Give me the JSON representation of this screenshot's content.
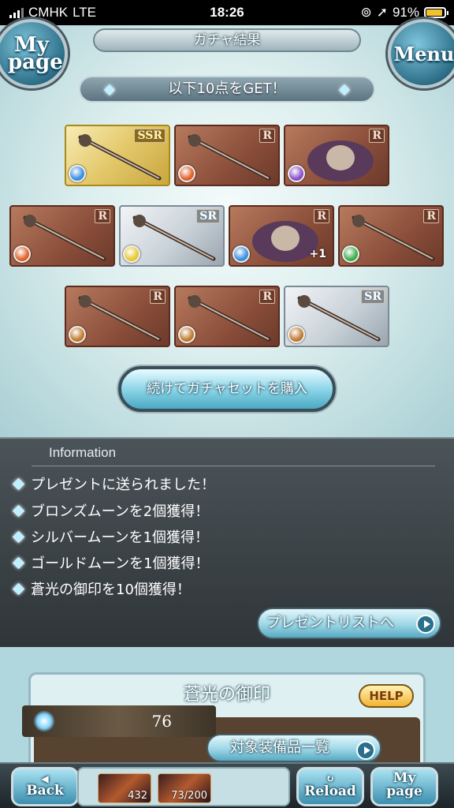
{
  "status": {
    "carrier": "CMHK",
    "network": "LTE",
    "time": "18:26",
    "battery": "91%",
    "battery_level": 0.91
  },
  "header": {
    "title": "ガチャ結果",
    "mypage_label": "My page",
    "menu_label": "Menu"
  },
  "banner": "以下10点をGET！",
  "cards": [
    {
      "rarity": "SSR",
      "element": "water",
      "color": "#3a8fe0"
    },
    {
      "rarity": "R",
      "element": "fire",
      "color": "#e0602a"
    },
    {
      "rarity": "R",
      "element": "dark",
      "color": "#8a4fc9"
    },
    {
      "rarity": "R",
      "element": "fire",
      "color": "#e0602a"
    },
    {
      "rarity": "SR",
      "element": "light",
      "color": "#e8c830"
    },
    {
      "rarity": "R",
      "element": "water",
      "color": "#3a8fe0",
      "bonus": "+1"
    },
    {
      "rarity": "R",
      "element": "wind",
      "color": "#3fae4a"
    },
    {
      "rarity": "R",
      "element": "earth",
      "color": "#c07a2e"
    },
    {
      "rarity": "R",
      "element": "earth",
      "color": "#c07a2e"
    },
    {
      "rarity": "SR",
      "element": "earth",
      "color": "#c07a2e"
    }
  ],
  "buy_button": "続けてガチャセットを購入",
  "info": {
    "heading": "Information",
    "messages": [
      "プレゼントに送られました！",
      "ブロンズムーンを2個獲得！",
      "シルバームーンを1個獲得！",
      "ゴールドムーンを1個獲得！",
      "蒼光の御印を10個獲得！"
    ],
    "present_button": "プレゼントリストへ"
  },
  "panel": {
    "title": "蒼光の御印",
    "help": "HELP",
    "count": "76",
    "list_button": "対象装備品一覧"
  },
  "nav": {
    "back": "Back",
    "reload": "Reload",
    "mypage": "My page",
    "item1_count": "432",
    "item2_count": "73/200"
  }
}
